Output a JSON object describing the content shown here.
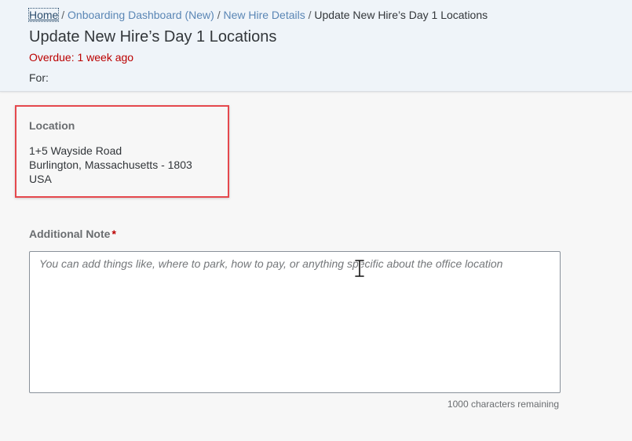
{
  "breadcrumb": {
    "home": "Home",
    "separator": "/",
    "onboarding_dashboard": "Onboarding Dashboard (New)",
    "new_hire_details": "New Hire Details",
    "current": "Update New Hire’s Day 1 Locations"
  },
  "header": {
    "title": "Update New Hire’s Day 1 Locations",
    "overdue": "Overdue: 1 week ago",
    "for_label": "For:"
  },
  "location": {
    "heading": "Location",
    "line1": "1+5 Wayside Road",
    "line2": "Burlington, Massachusetts - 1803",
    "line3": "USA"
  },
  "note": {
    "label": "Additional Note",
    "required_marker": "*",
    "placeholder": "You can add things like, where to park, how to pay, or anything specific about the office location",
    "value": "",
    "chars_remaining": "1000 characters remaining"
  },
  "colors": {
    "header_bg": "#eff4f9",
    "link": "#5a86b5",
    "overdue": "#bb0000",
    "highlight_border": "#e5484d",
    "page_bg": "#f7f7f7"
  },
  "icons": {
    "cursor": "text-cursor-icon"
  }
}
